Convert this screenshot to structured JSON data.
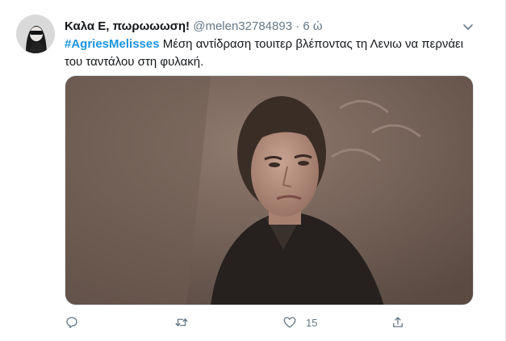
{
  "tweet": {
    "display_name": "Καλα Ε, πωρωωωση!",
    "handle": "@melen32784893",
    "separator": "·",
    "time": "6 ώ",
    "hashtag": "#AgriesMelisses",
    "text": " Μέση αντίδραση τουιτερ βλέποντας τη Λενιω να περνάει του ταντάλου στη φυλακή."
  },
  "actions": {
    "reply": {
      "icon": "reply-icon"
    },
    "retweet": {
      "icon": "retweet-icon"
    },
    "like": {
      "icon": "heart-icon",
      "count": "15"
    },
    "share": {
      "icon": "share-icon"
    }
  },
  "colors": {
    "link": "#1b95e0",
    "secondary_text": "#657786",
    "primary_text": "#14171a"
  }
}
